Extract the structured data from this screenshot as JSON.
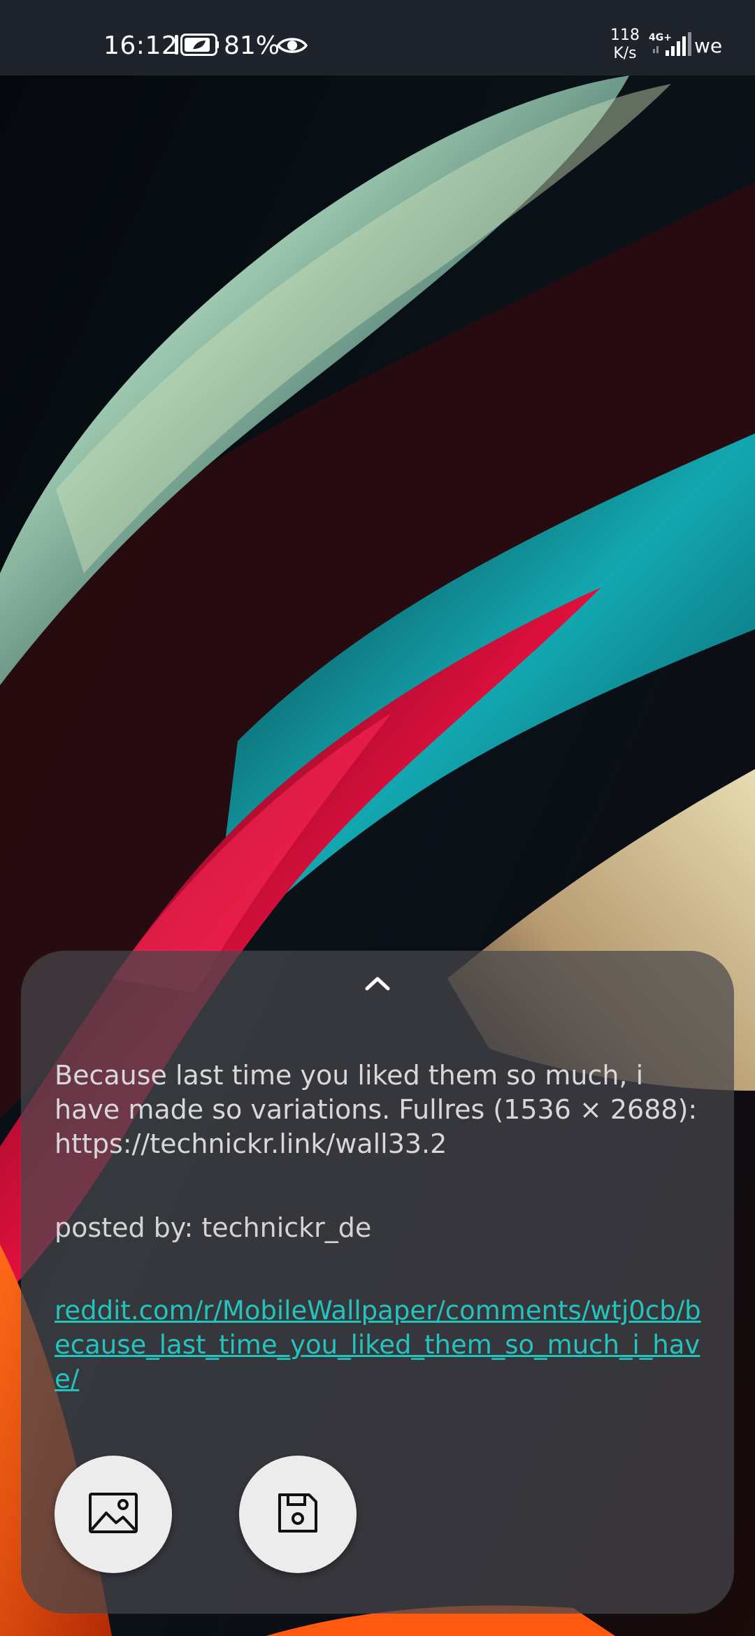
{
  "status_bar": {
    "time": "16:12",
    "battery": "81%",
    "net_speed_value": "118",
    "net_speed_unit": "K/s",
    "network_type": "4G+",
    "carrier": "we",
    "icons": [
      "sim-icon",
      "battery-icon",
      "eye-icon",
      "signal-icon"
    ]
  },
  "post": {
    "description": "Because last time you liked them so much, i have made so variations. Fullres (1536 × 2688): https://technickr.link/wall33.2",
    "author": "posted by: technickr_de",
    "link": "reddit.com/r/MobileWallpaper/comments/wtj0cb/because_last_time_you_liked_them_so_much_i_have/"
  },
  "sheet": {
    "handle_icon": "chevron-up-icon",
    "actions": [
      {
        "name": "set-wallpaper",
        "icon": "image-icon"
      },
      {
        "name": "save",
        "icon": "floppy-disk-icon"
      }
    ]
  },
  "colors": {
    "status_bar_bg": "#1f232b",
    "link": "#22c4bd",
    "sheet_bg": "rgba(70,70,76,0.72)",
    "fab_bg": "#ececec"
  }
}
